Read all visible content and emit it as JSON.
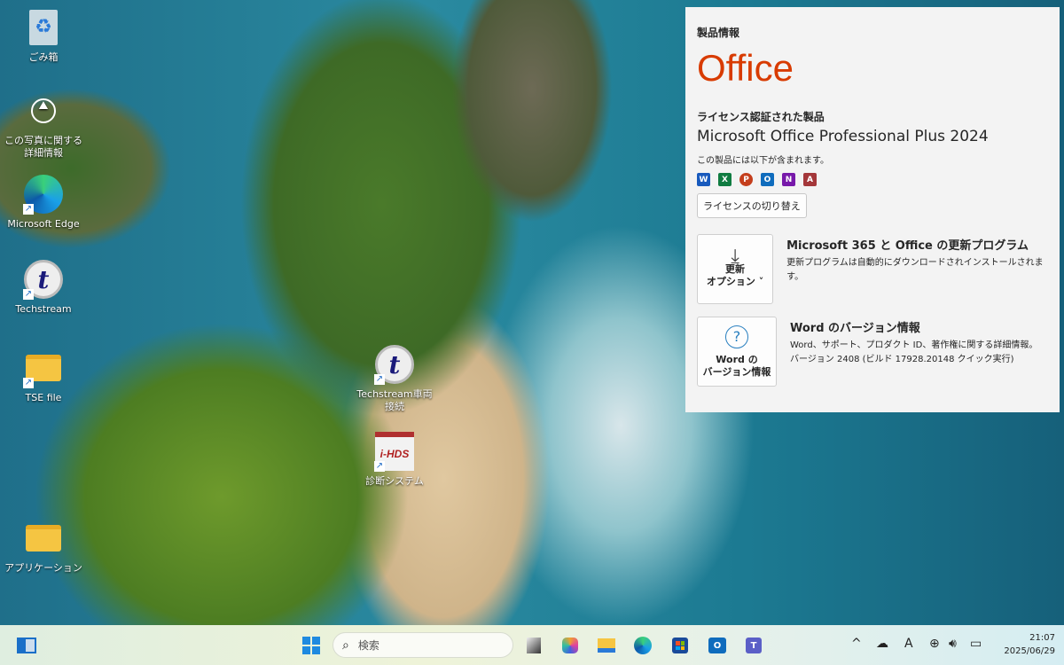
{
  "desktop": {
    "icons": [
      {
        "label": "ごみ箱",
        "icon": "recycle-bin-icon"
      },
      {
        "label": "この写真に関する詳細情報",
        "icon": "photo-info-icon"
      },
      {
        "label": "Microsoft Edge",
        "icon": "edge-icon"
      },
      {
        "label": "Techstream",
        "icon": "techstream-icon"
      },
      {
        "label": "TSE file",
        "icon": "folder-icon"
      },
      {
        "label": "アプリケーション",
        "icon": "folder-icon"
      },
      {
        "label": "Techstream車両接続",
        "icon": "techstream-icon"
      },
      {
        "label": "診断システム",
        "icon": "ihds-icon",
        "logo_text": "i-HDS"
      }
    ]
  },
  "panel": {
    "heading": "製品情報",
    "brand": "Office",
    "licensed_label": "ライセンス認証された製品",
    "product_name": "Microsoft Office Professional Plus 2024",
    "includes_label": "この製品には以下が含まれます。",
    "apps": [
      {
        "letter": "W",
        "color": "#185abd"
      },
      {
        "letter": "X",
        "color": "#107c41"
      },
      {
        "letter": "P",
        "color": "#c43e1c"
      },
      {
        "letter": "O",
        "color": "#0f6cbd"
      },
      {
        "letter": "N",
        "color": "#7719aa"
      },
      {
        "letter": "A",
        "color": "#a4373a"
      }
    ],
    "switch_license": "ライセンスの切り替え",
    "update": {
      "tile_line1": "更新",
      "tile_line2": "オプション ˅",
      "title": "Microsoft 365 と Office の更新プログラム",
      "desc": "更新プログラムは自動的にダウンロードされインストールされます。"
    },
    "about": {
      "tile_line1": "Word の",
      "tile_line2": "バージョン情報",
      "title": "Word のバージョン情報",
      "desc": "Word、サポート、プロダクト ID、著作権に関する詳細情報。",
      "version": "バージョン 2408 (ビルド 17928.20148 クイック実行)"
    }
  },
  "taskbar": {
    "search_placeholder": "検索",
    "time": "21:07",
    "date": "2025/06/29"
  }
}
